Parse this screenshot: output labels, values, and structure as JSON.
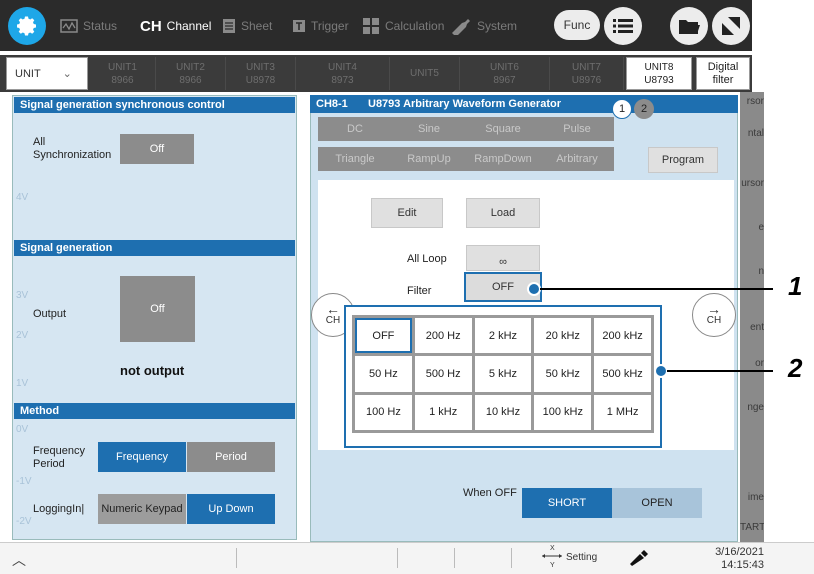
{
  "toolbar": {
    "tabs": [
      {
        "icon": "status-icon",
        "label": "Status"
      },
      {
        "icon": "ch-icon",
        "label": "Channel",
        "prefix": "CH"
      },
      {
        "icon": "sheet-icon",
        "label": "Sheet"
      },
      {
        "icon": "trigger-icon",
        "label": "Trigger"
      },
      {
        "icon": "calculation-icon",
        "label": "Calculation"
      },
      {
        "icon": "system-icon",
        "label": "System"
      }
    ],
    "func_label": "Func"
  },
  "units": {
    "selector": "UNIT",
    "items": [
      {
        "name": "UNIT1",
        "model": "8966"
      },
      {
        "name": "UNIT2",
        "model": "8966"
      },
      {
        "name": "UNIT3",
        "model": "U8978"
      },
      {
        "name": "UNIT4",
        "model": "8973"
      },
      {
        "name": "UNIT5",
        "model": ""
      },
      {
        "name": "UNIT6",
        "model": "8967"
      },
      {
        "name": "UNIT7",
        "model": "U8976"
      },
      {
        "name": "UNIT8",
        "model": "U8793"
      }
    ],
    "digital_filter": [
      "Digital",
      "filter"
    ]
  },
  "right_strip_labels": [
    "rsor",
    "ntal",
    "ursor",
    "e",
    "n",
    "ent",
    "or",
    "nge",
    "ime",
    "TART"
  ],
  "left_panel": {
    "sync_header": "Signal generation synchronous control",
    "all_sync_label": [
      "All",
      "Synchronization"
    ],
    "all_sync_value": "Off",
    "siggen_header": "Signal generation",
    "output_label": "Output",
    "output_value": "Off",
    "output_status": "not output",
    "method_header": "Method",
    "freq_period_label": [
      "Frequency",
      "Period"
    ],
    "freq_option": "Frequency",
    "period_option": "Period",
    "logging_label": "LoggingIn|",
    "numeric_option": "Numeric Keypad",
    "updown_option": "Up Down",
    "bg_ticks": [
      "4V",
      "3V",
      "2V",
      "1V",
      "0V",
      "-1V",
      "-2V"
    ]
  },
  "right_panel": {
    "channel": "CH8-1",
    "title": "U8793 Arbitrary Waveform Generator",
    "pages": [
      "1",
      "2"
    ],
    "waves_row1": [
      "DC",
      "Sine",
      "Square",
      "Pulse"
    ],
    "waves_row2": [
      "Triangle",
      "RampUp",
      "RampDown",
      "Arbitrary"
    ],
    "program_label": "Program",
    "edit_label": "Edit",
    "load_label": "Load",
    "all_loop_label": "All Loop",
    "all_loop_value": "∞",
    "filter_label": "Filter",
    "filter_value": "OFF",
    "prev_ch": "CH",
    "next_ch": "CH",
    "filter_options": [
      "OFF",
      "200 Hz",
      "2 kHz",
      "20 kHz",
      "200 kHz",
      "50 Hz",
      "500 Hz",
      "5 kHz",
      "50 kHz",
      "500 kHz",
      "100 Hz",
      "1 kHz",
      "10 kHz",
      "100 kHz",
      "1 MHz"
    ],
    "when_off_label": "When OFF",
    "short_label": "SHORT",
    "open_label": "OPEN"
  },
  "callouts": [
    "1",
    "2"
  ],
  "statusbar": {
    "setting_label": "Setting",
    "axis_x": "X",
    "axis_y": "Y",
    "date": "3/16/2021",
    "time": "14:15:43"
  }
}
